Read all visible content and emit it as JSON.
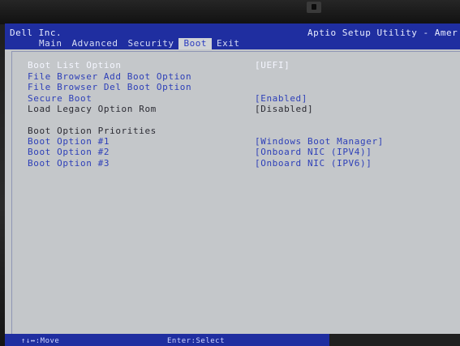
{
  "header": {
    "vendor": "Dell Inc.",
    "utility": "Aptio Setup Utility - Amer"
  },
  "tabs": [
    {
      "label": "Main",
      "active": false
    },
    {
      "label": "Advanced",
      "active": false
    },
    {
      "label": "Security",
      "active": false
    },
    {
      "label": "Boot",
      "active": true
    },
    {
      "label": "Exit",
      "active": false
    }
  ],
  "items": [
    {
      "label": "Boot List Option",
      "value": "[UEFI]"
    },
    {
      "label": "File Browser Add Boot Option",
      "value": ""
    },
    {
      "label": "File Browser Del Boot Option",
      "value": ""
    },
    {
      "label": "Secure Boot",
      "value": "[Enabled]"
    },
    {
      "label": "Load Legacy Option Rom",
      "value": "[Disabled]"
    },
    {
      "label": "Boot Option Priorities",
      "value": ""
    },
    {
      "label": "Boot Option #1",
      "value": "[Windows Boot Manager]"
    },
    {
      "label": "Boot Option #2",
      "value": "[Onboard NIC (IPV4)]"
    },
    {
      "label": "Boot Option #3",
      "value": "[Onboard NIC (IPV6)]"
    }
  ],
  "footer": {
    "move_hint": "↑↓↔:Move",
    "select_hint": "Enter:Select"
  },
  "colors": {
    "title_bar": "#1f2ea0",
    "screen_bg": "#c4c7ca",
    "highlight": "#f4f6ff",
    "option_blue": "#2d3fb8"
  }
}
